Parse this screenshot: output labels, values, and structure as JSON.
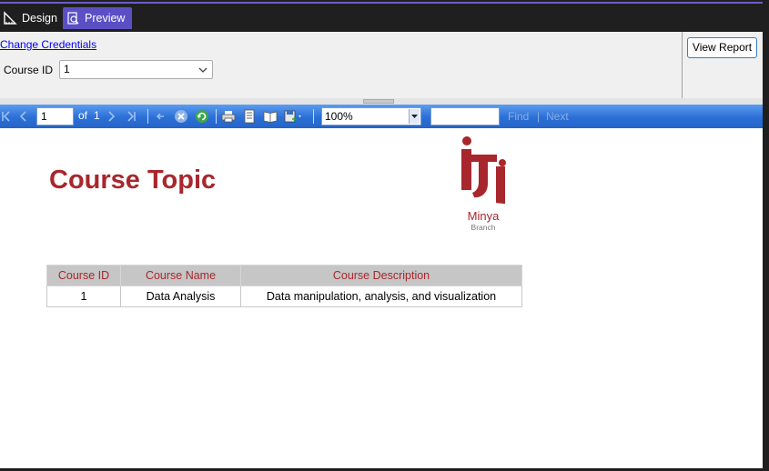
{
  "tabs": [
    {
      "label": "Design",
      "icon": "design-ruler-icon"
    },
    {
      "label": "Preview",
      "icon": "preview-icon"
    }
  ],
  "params": {
    "credentials_link": "Change Credentials",
    "course_id_label": "Course ID",
    "course_id_value": "1",
    "view_report_label": "View Report"
  },
  "toolbar": {
    "page_value": "1",
    "of_label": "of",
    "total_pages": "1",
    "zoom_value": "100%",
    "find_label": "Find",
    "find_sep": "|",
    "next_label": "Next"
  },
  "report": {
    "title": "Course Topic",
    "logo_city": "Minya",
    "logo_sub": "Branch",
    "columns": [
      "Course ID",
      "Course Name",
      "Course Description"
    ],
    "rows": [
      [
        "1",
        "Data Analysis",
        "Data manipulation, analysis, and visualization"
      ]
    ]
  },
  "colors": {
    "accent": "#6c5ec9",
    "brand_red": "#a8272d",
    "toolbar_blue": "#2b6fd6"
  }
}
